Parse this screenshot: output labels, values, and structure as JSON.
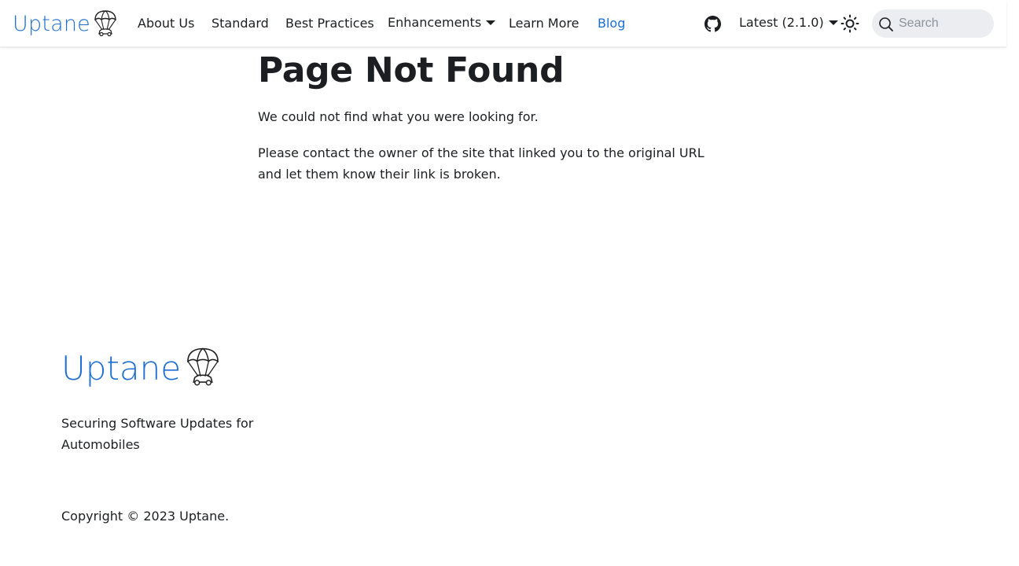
{
  "navbar": {
    "brand_name": "Uptane",
    "links": [
      {
        "label": "About Us"
      },
      {
        "label": "Standard"
      },
      {
        "label": "Best Practices"
      },
      {
        "label": "Enhancements"
      },
      {
        "label": "Learn More"
      },
      {
        "label": "Blog"
      }
    ],
    "version_label": "Latest (2.1.0)",
    "search_placeholder": "Search",
    "icons": [
      "github-icon",
      "sun-icon",
      "search-icon",
      "parachute-car-icon"
    ],
    "active_link_color": "#1a6fd6"
  },
  "main": {
    "title": "Page Not Found",
    "paragraphs": [
      "We could not find what you were looking for.",
      "Please contact the owner of the site that linked you to the original URL and let them know their link is broken."
    ]
  },
  "footer": {
    "brand_name": "Uptane",
    "tagline": "Securing Software Updates for Automobiles",
    "copyright": "Copyright © 2023 Uptane."
  },
  "colors": {
    "brand_blue": "#1f6fd0",
    "text": "#1c1e21",
    "search_bg": "#ebedf0"
  }
}
